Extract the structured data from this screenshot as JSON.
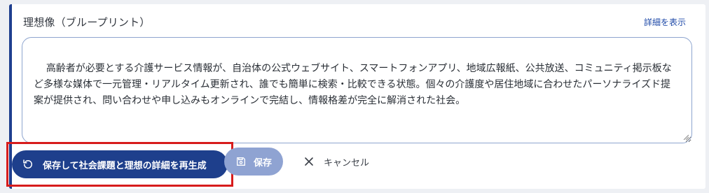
{
  "section": {
    "title": "理想像（ブループリント）",
    "detail_link": "詳細を表示"
  },
  "editor": {
    "text": "高齢者が必要とする介護サービス情報が、自治体の公式ウェブサイト、スマートフォンアプリ、地域広報紙、公共放送、コミュニティ掲示板など多様な媒体で一元管理・リアルタイム更新され、誰でも簡単に検索・比較できる状態。個々の介護度や居住地域に合わせたパーソナライズド提案が提供され、問い合わせや申し込みもオンラインで完結し、情報格差が完全に解消された社会。"
  },
  "actions": {
    "regenerate_label": "保存して社会課題と理想の詳細を再生成",
    "regenerate_icon": "refresh-icon",
    "save_label": "保存",
    "save_icon": "save-icon",
    "cancel_label": "キャンセル",
    "cancel_icon": "close-icon"
  },
  "colors": {
    "accent": "#1e3f8c",
    "save_disabled": "#8fa3d2",
    "highlight_border": "#d71c1c",
    "link": "#1f4aa8"
  }
}
